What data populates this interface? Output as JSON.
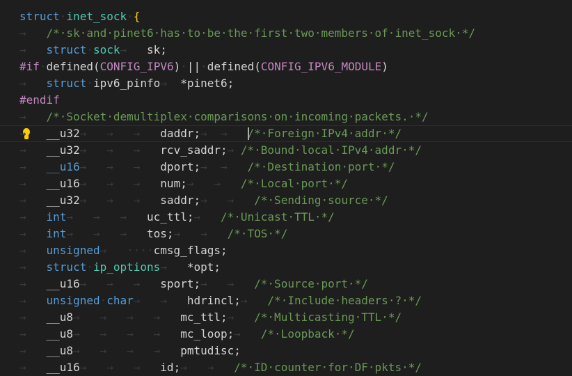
{
  "editor": {
    "lines": [
      [
        [
          "kw",
          "struct"
        ],
        [
          "ws",
          "·"
        ],
        [
          "st",
          "inet_sock"
        ],
        [
          "ws",
          "·"
        ],
        [
          "br",
          "{"
        ]
      ],
      [
        [
          "tab",
          "→   "
        ],
        [
          "cm",
          "/*·sk·and·pinet6·has·to·be·the·first·two·members·of·inet_sock·*/"
        ]
      ],
      [
        [
          "tab",
          "→   "
        ],
        [
          "kw",
          "struct"
        ],
        [
          "ws",
          "·"
        ],
        [
          "st",
          "sock"
        ],
        [
          "tab",
          "→   "
        ],
        [
          "tx",
          "sk;"
        ]
      ],
      [
        [
          "pp",
          "#if"
        ],
        [
          "ws",
          "·"
        ],
        [
          "tx",
          "defined"
        ],
        [
          "tx",
          "("
        ],
        [
          "pp",
          "CONFIG_IPV6"
        ],
        [
          "tx",
          ")"
        ],
        [
          "ws",
          "·"
        ],
        [
          "tx",
          "||"
        ],
        [
          "ws",
          "·"
        ],
        [
          "tx",
          "defined"
        ],
        [
          "tx",
          "("
        ],
        [
          "pp",
          "CONFIG_IPV6_MODULE"
        ],
        [
          "tx",
          ")"
        ]
      ],
      [
        [
          "tab",
          "→   "
        ],
        [
          "kw",
          "struct"
        ],
        [
          "ws",
          "·"
        ],
        [
          "tx",
          "ipv6_pinfo"
        ],
        [
          "tab",
          "→  "
        ],
        [
          "tx",
          "*pinet6;"
        ]
      ],
      [
        [
          "pp",
          "#endif"
        ]
      ],
      [
        [
          "tab",
          "→   "
        ],
        [
          "cm",
          "/*·Socket·demultiplex·comparisons·on·incoming·packets.·*/"
        ]
      ],
      [
        [
          "tab",
          "→   "
        ],
        [
          "tx",
          "__u32"
        ],
        [
          "tab",
          "→   →   →   "
        ],
        [
          "tx",
          "daddr;"
        ],
        [
          "tab",
          "→  →   "
        ],
        [
          "caret",
          ""
        ],
        [
          "cm",
          "/*·Foreign·IPv4·addr·*/"
        ]
      ],
      [
        [
          "tab",
          "→   "
        ],
        [
          "tx",
          "__u32"
        ],
        [
          "tab",
          "→   →   →   "
        ],
        [
          "tx",
          "rcv_saddr;"
        ],
        [
          "tab",
          "→ "
        ],
        [
          "cm",
          "/*·Bound·local·IPv4·addr·*/"
        ]
      ],
      [
        [
          "tab",
          "→   "
        ],
        [
          "kw",
          "__u16"
        ],
        [
          "tab",
          "→   →   →   "
        ],
        [
          "tx",
          "dport;"
        ],
        [
          "tab",
          "→  →   "
        ],
        [
          "cm",
          "/*·Destination·port·*/"
        ]
      ],
      [
        [
          "tab",
          "→   "
        ],
        [
          "tx",
          "__u16"
        ],
        [
          "tab",
          "→   →   →   "
        ],
        [
          "tx",
          "num;"
        ],
        [
          "tab",
          "→   →   "
        ],
        [
          "cm",
          "/*·Local·port·*/"
        ]
      ],
      [
        [
          "tab",
          "→   "
        ],
        [
          "tx",
          "__u32"
        ],
        [
          "tab",
          "→   →   →   "
        ],
        [
          "tx",
          "saddr;"
        ],
        [
          "tab",
          "→   →   "
        ],
        [
          "cm",
          "/*·Sending·source·*/"
        ]
      ],
      [
        [
          "tab",
          "→   "
        ],
        [
          "kw",
          "int"
        ],
        [
          "tab",
          "→   →   →   "
        ],
        [
          "tx",
          "uc_ttl;"
        ],
        [
          "tab",
          "→   "
        ],
        [
          "cm",
          "/*·Unicast·TTL·*/"
        ]
      ],
      [
        [
          "tab",
          "→   "
        ],
        [
          "kw",
          "int"
        ],
        [
          "tab",
          "→   →   →   "
        ],
        [
          "tx",
          "tos;"
        ],
        [
          "tab",
          "→   →   "
        ],
        [
          "cm",
          "/*·TOS·*/"
        ]
      ],
      [
        [
          "tab",
          "→   "
        ],
        [
          "kw",
          "unsigned"
        ],
        [
          "tab",
          "→   "
        ],
        [
          "ws",
          "····"
        ],
        [
          "tx",
          "cmsg_flags;"
        ]
      ],
      [
        [
          "tab",
          "→   "
        ],
        [
          "kw",
          "struct"
        ],
        [
          "ws",
          "·"
        ],
        [
          "st",
          "ip_options"
        ],
        [
          "tab",
          "→   "
        ],
        [
          "tx",
          "*opt;"
        ]
      ],
      [
        [
          "tab",
          "→   "
        ],
        [
          "tx",
          "__u16"
        ],
        [
          "tab",
          "→   →   →   "
        ],
        [
          "tx",
          "sport;"
        ],
        [
          "tab",
          "→   →   "
        ],
        [
          "cm",
          "/*·Source·port·*/"
        ]
      ],
      [
        [
          "tab",
          "→   "
        ],
        [
          "kw",
          "unsigned"
        ],
        [
          "ws",
          "·"
        ],
        [
          "kw",
          "char"
        ],
        [
          "tab",
          "→   →   "
        ],
        [
          "tx",
          "hdrincl;"
        ],
        [
          "tab",
          "→   "
        ],
        [
          "cm",
          "/*·Include·headers·?·*/"
        ]
      ],
      [
        [
          "tab",
          "→   "
        ],
        [
          "tx",
          "__u8"
        ],
        [
          "tab",
          "→   →   →   →   "
        ],
        [
          "tx",
          "mc_ttl;"
        ],
        [
          "tab",
          "→   "
        ],
        [
          "cm",
          "/*·Multicasting·TTL·*/"
        ]
      ],
      [
        [
          "tab",
          "→   "
        ],
        [
          "tx",
          "__u8"
        ],
        [
          "tab",
          "→   →   →   →   "
        ],
        [
          "tx",
          "mc_loop;"
        ],
        [
          "tab",
          "→   "
        ],
        [
          "cm",
          "/*·Loopback·*/"
        ]
      ],
      [
        [
          "tab",
          "→   "
        ],
        [
          "tx",
          "__u8"
        ],
        [
          "tab",
          "→   →   →   →   "
        ],
        [
          "tx",
          "pmtudisc;"
        ]
      ],
      [
        [
          "tab",
          "→   "
        ],
        [
          "tx",
          "__u16"
        ],
        [
          "tab",
          "→   →   →   "
        ],
        [
          "tx",
          "id;"
        ],
        [
          "tab",
          "→   →   "
        ],
        [
          "cm",
          "/*·ID·counter·for·DF·pkts·*/"
        ]
      ]
    ],
    "current_line_index": 7,
    "lightbulb_icon": "lightbulb-icon"
  }
}
